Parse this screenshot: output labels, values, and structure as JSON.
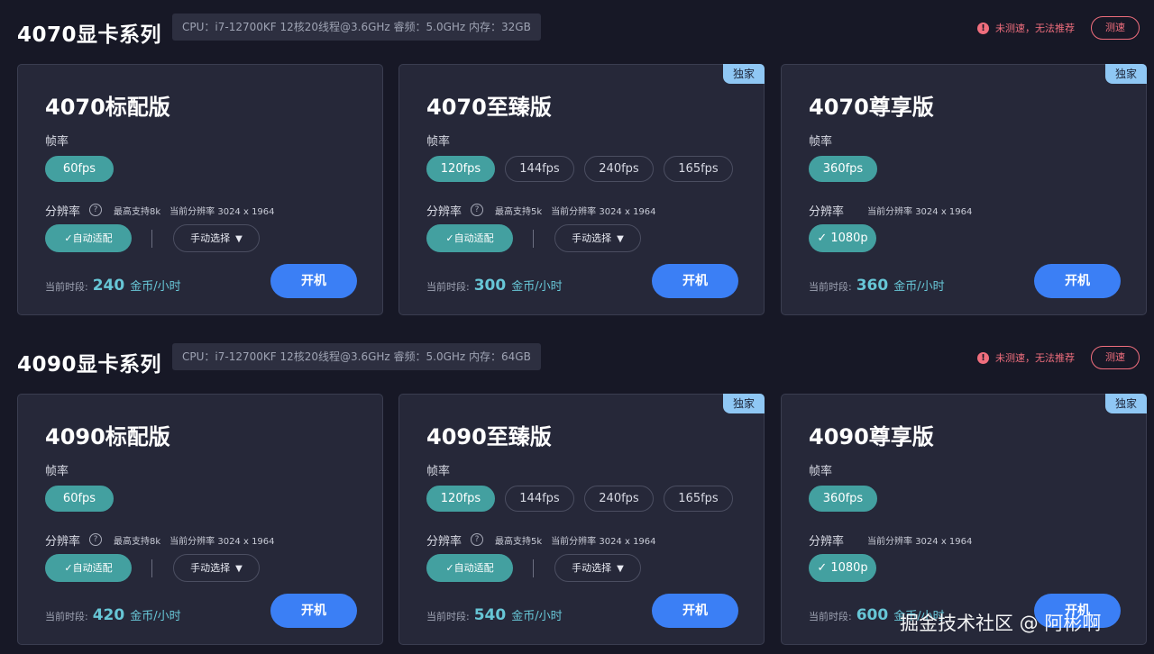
{
  "series": [
    {
      "title": "4070显卡系列",
      "cpu": "CPU：i7-12700KF 12核20线程@3.6GHz 睿频：5.0GHz 内存：32GB",
      "warning": "未测速，无法推荐",
      "speed_test": "测速",
      "cards": [
        {
          "title": "4070标配版",
          "exclusive": "",
          "fps_label": "帧率",
          "fps": [
            "60fps"
          ],
          "res_label": "分辨率",
          "res_max": "最高支持8k",
          "res_current": "当前分辨率 3024 x 1964",
          "auto_label": "✓自动适配",
          "manual_label": "手动选择",
          "res_option": "",
          "price_label": "当前时段:",
          "price": "240",
          "unit": "金币/小时",
          "start_label": "开机"
        },
        {
          "title": "4070至臻版",
          "exclusive": "独家",
          "fps_label": "帧率",
          "fps": [
            "120fps",
            "144fps",
            "240fps",
            "165fps"
          ],
          "res_label": "分辨率",
          "res_max": "最高支持5k",
          "res_current": "当前分辨率 3024 x 1964",
          "auto_label": "✓自动适配",
          "manual_label": "手动选择",
          "res_option": "",
          "price_label": "当前时段:",
          "price": "300",
          "unit": "金币/小时",
          "start_label": "开机"
        },
        {
          "title": "4070尊享版",
          "exclusive": "独家",
          "fps_label": "帧率",
          "fps": [
            "360fps"
          ],
          "res_label": "分辨率",
          "res_max": "",
          "res_current": "当前分辨率 3024 x 1964",
          "auto_label": "",
          "manual_label": "",
          "res_option": "✓ 1080p",
          "price_label": "当前时段:",
          "price": "360",
          "unit": "金币/小时",
          "start_label": "开机"
        }
      ]
    },
    {
      "title": "4090显卡系列",
      "cpu": "CPU：i7-12700KF 12核20线程@3.6GHz 睿频：5.0GHz 内存：64GB",
      "warning": "未测速，无法推荐",
      "speed_test": "测速",
      "cards": [
        {
          "title": "4090标配版",
          "exclusive": "",
          "fps_label": "帧率",
          "fps": [
            "60fps"
          ],
          "res_label": "分辨率",
          "res_max": "最高支持8k",
          "res_current": "当前分辨率 3024 x 1964",
          "auto_label": "✓自动适配",
          "manual_label": "手动选择",
          "res_option": "",
          "price_label": "当前时段:",
          "price": "420",
          "unit": "金币/小时",
          "start_label": "开机"
        },
        {
          "title": "4090至臻版",
          "exclusive": "独家",
          "fps_label": "帧率",
          "fps": [
            "120fps",
            "144fps",
            "240fps",
            "165fps"
          ],
          "res_label": "分辨率",
          "res_max": "最高支持5k",
          "res_current": "当前分辨率 3024 x 1964",
          "auto_label": "✓自动适配",
          "manual_label": "手动选择",
          "res_option": "",
          "price_label": "当前时段:",
          "price": "540",
          "unit": "金币/小时",
          "start_label": "开机"
        },
        {
          "title": "4090尊享版",
          "exclusive": "独家",
          "fps_label": "帧率",
          "fps": [
            "360fps"
          ],
          "res_label": "分辨率",
          "res_max": "",
          "res_current": "当前分辨率 3024 x 1964",
          "auto_label": "",
          "manual_label": "",
          "res_option": "✓ 1080p",
          "price_label": "当前时段:",
          "price": "600",
          "unit": "金币/小时",
          "start_label": "开机"
        }
      ]
    }
  ],
  "watermark": "掘金技术社区 @ 阿彬啊",
  "colors": {
    "background": "#171826",
    "card": "#262839",
    "accent_teal": "#43a0a0",
    "primary_blue": "#3b7ff5",
    "price_cyan": "#67c6d6",
    "warning_red": "#f06e7d",
    "exclusive_badge": "#8fc7f4"
  }
}
